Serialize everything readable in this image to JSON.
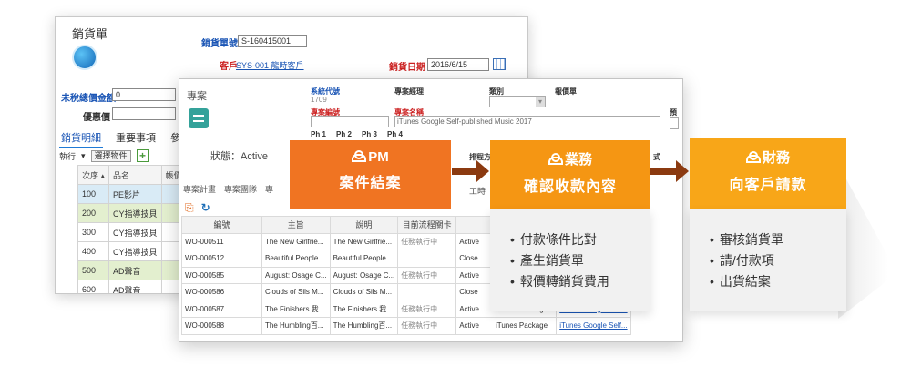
{
  "sales_order": {
    "title": "銷貨單",
    "order_no_label": "銷貨單號",
    "order_no_value": "S-160415001",
    "customer_label": "客戶",
    "customer_value": "SYS-001 龍時客戶",
    "date_label": "銷貨日期",
    "date_value": "2016/6/15",
    "untaxed_label": "未稅總價金額",
    "untaxed_value": "0",
    "discount_label": "優惠價",
    "tabs": [
      "銷貨明細",
      "重要事項",
      "參"
    ],
    "toolbar_action": "執行",
    "toolbar_select": "選擇物件",
    "columns": [
      "次序",
      "品名",
      "帳價"
    ],
    "rows": [
      {
        "seq": "100",
        "name": "PE影片",
        "style": "hl"
      },
      {
        "seq": "200",
        "name": "CY指導技貝",
        "style": "gr"
      },
      {
        "seq": "300",
        "name": "CY指導技貝",
        "style": ""
      },
      {
        "seq": "400",
        "name": "CY指導技貝",
        "style": ""
      },
      {
        "seq": "500",
        "name": "AD聲音",
        "style": "gr"
      },
      {
        "seq": "600",
        "name": "AD聲音",
        "style": ""
      }
    ]
  },
  "project": {
    "title": "專案",
    "status": "狀態：Active",
    "system_code_label": "系統代號",
    "system_code_value": "1709",
    "pm_label": "專案經理",
    "category_label": "類別",
    "quote_label": "報價單",
    "project_no_label": "專案編號",
    "project_name_label": "專案名稱",
    "project_name_value": "iTunes Google Self-published Music 2017",
    "forecast_label": "預",
    "phases": [
      "Ph 1",
      "Ph 2",
      "Ph 3",
      "Ph 4"
    ],
    "schedule_label": "排程方",
    "format_label": "式",
    "tabs": [
      "專案計畫",
      "專案團隊",
      "專"
    ],
    "extra_tab": "工時",
    "columns": [
      "編號",
      "主旨",
      "說明",
      "目前流程關卡",
      "",
      "[...]"
    ],
    "rows": [
      {
        "id": "WO-000511",
        "subject": "The New Girlfrie...",
        "desc": "The New Girlfrie...",
        "stage": "任務執行中",
        "status": "Active",
        "pkg": "",
        "link": "Tunes Google Self..."
      },
      {
        "id": "WO-000512",
        "subject": "Beautiful People ...",
        "desc": "Beautiful People ...",
        "stage": "",
        "status": "Close",
        "pkg": "",
        "link": "Tunes Google Self..."
      },
      {
        "id": "WO-000585",
        "subject": "August: Osage C...",
        "desc": "August: Osage C...",
        "stage": "任務執行中",
        "status": "Active",
        "pkg": "",
        "link": "Tunes Google Self..."
      },
      {
        "id": "WO-000586",
        "subject": "Clouds of Sils M...",
        "desc": "Clouds of Sils M...",
        "stage": "",
        "status": "Close",
        "pkg": "",
        "link": "Tunes Google Self..."
      },
      {
        "id": "WO-000587",
        "subject": "The Finishers 我...",
        "desc": "The Finishers 我...",
        "stage": "任務執行中",
        "status": "Active",
        "pkg": "iTunes Package",
        "link": "iTunes Google Self..."
      },
      {
        "id": "WO-000588",
        "subject": "The Humbling百...",
        "desc": "The Humbling百...",
        "stage": "任務執行中",
        "status": "Active",
        "pkg": "iTunes Package",
        "link": "iTunes Google Self..."
      }
    ]
  },
  "process": [
    {
      "role": "PM",
      "action": "案件結案",
      "color": "#f07422",
      "bullets": []
    },
    {
      "role": "業務",
      "action": "確認收款內容",
      "color": "#f59613",
      "bullets": [
        "付款條件比對",
        "產生銷貨單",
        "報價轉銷貨費用"
      ]
    },
    {
      "role": "財務",
      "action": "向客戶請款",
      "color": "#f8a618",
      "bullets": [
        "審核銷貨單",
        "請/付款項",
        "出貨結案"
      ]
    }
  ]
}
